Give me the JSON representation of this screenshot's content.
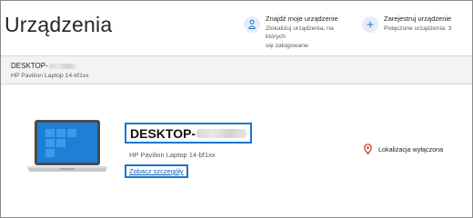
{
  "page": {
    "title": "Urządzenia"
  },
  "actions": {
    "find": {
      "title": "Znajdź moje urządzenie",
      "sub_line1": "Zlokalizuj urządzenia, na których",
      "sub_line2": "się zalogowane",
      "icon": "person-location-icon"
    },
    "register": {
      "title": "Zarejestruj urządzenie",
      "sub_line1": "Połączone urządzenia: 3",
      "icon": "plus-icon"
    }
  },
  "device_header": {
    "name": "DESKTOP-",
    "model": "HP Pavilion Laptop 14-bf1xx"
  },
  "device": {
    "name": "DESKTOP-",
    "model": "HP Pavilion Laptop 14-bf1xx",
    "details_link": "Zobacz szczegóły",
    "location_status": "Lokalizacja wyłączona",
    "icon": "laptop-icon"
  },
  "colors": {
    "accent": "#1d74c9",
    "link": "#0b63c4",
    "location_pin": "#c42b1c",
    "icon_circle": "#e6edf6"
  }
}
